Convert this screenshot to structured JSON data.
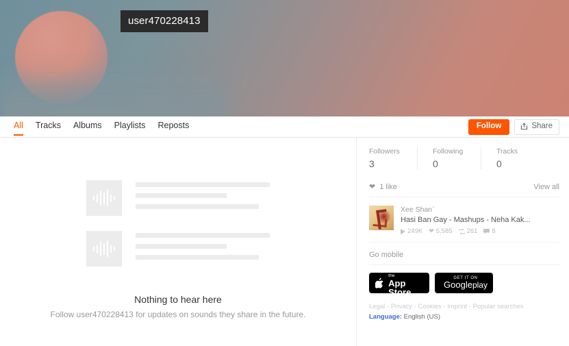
{
  "banner": {
    "username": "user470228413",
    "bg_left_color": "#6f909c",
    "bg_right_color": "#cd8272",
    "badge_bg": "#2b2b2b"
  },
  "tabs": [
    {
      "label": "All",
      "active": true
    },
    {
      "label": "Tracks",
      "active": false
    },
    {
      "label": "Albums",
      "active": false
    },
    {
      "label": "Playlists",
      "active": false
    },
    {
      "label": "Reposts",
      "active": false
    }
  ],
  "actions": {
    "follow_label": "Follow",
    "share_label": "Share",
    "share_icon": "share-icon",
    "accent_color": "#ff5500"
  },
  "empty_state": {
    "title": "Nothing to hear here",
    "subtitle": "Follow user470228413 for updates on sounds they share in the future.",
    "placeholder_icon": "waveform-icon"
  },
  "sidebar": {
    "stats": [
      {
        "label": "Followers",
        "value": "3"
      },
      {
        "label": "Following",
        "value": "0"
      },
      {
        "label": "Tracks",
        "value": "0"
      }
    ],
    "likes": {
      "heart_icon": "heart-icon",
      "count_label": "1 like",
      "view_all_label": "View all",
      "item": {
        "artist": "Xee Shan`",
        "title": "Hasi Ban Gay - Mashups - Neha Kak...",
        "artwork_icon": "track-artwork",
        "stats": [
          {
            "icon": "play-icon",
            "value": "249K"
          },
          {
            "icon": "heart-icon",
            "value": "5,585"
          },
          {
            "icon": "repost-icon",
            "value": "261"
          },
          {
            "icon": "comment-icon",
            "value": "8"
          }
        ]
      }
    },
    "go_mobile": {
      "label": "Go mobile",
      "app_store": {
        "icon": "apple-icon",
        "top_line": "Download on the",
        "main_line": "App Store"
      },
      "google_play": {
        "icon": "google-play-icon",
        "top_line": "GET IT ON",
        "main_line_bold": "Google",
        "main_line_light": "play"
      }
    },
    "footer": {
      "links": [
        "Legal",
        "Privacy",
        "Cookies",
        "Imprint",
        "Popular searches"
      ],
      "separator": " - ",
      "language_label": "Language:",
      "language_value": "English (US)"
    }
  }
}
